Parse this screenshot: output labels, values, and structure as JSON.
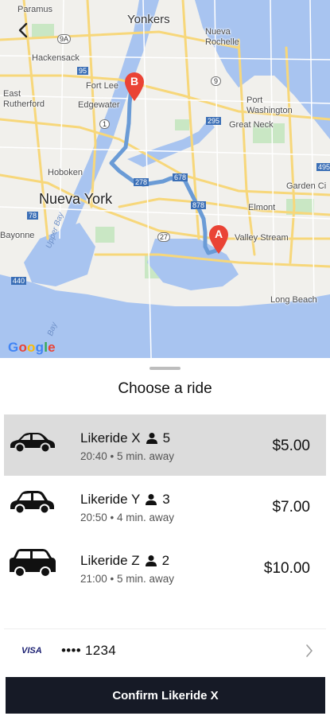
{
  "map": {
    "labels": {
      "paramus": "Paramus",
      "yonkers": "Yonkers",
      "nueva_rochelle": "Nueva\nRochelle",
      "hackensack": "Hackensack",
      "east_rutherford": "East\nRutherford",
      "fort_lee": "Fort Lee",
      "edgewater": "Edgewater",
      "port_washington": "Port\nWashington",
      "great_neck": "Great Neck",
      "hoboken": "Hoboken",
      "nueva_york": "Nueva York",
      "garden_city": "Garden Ci",
      "elmont": "Elmont",
      "valley_stream": "Valley Stream",
      "bayonne": "Bayonne",
      "upper_bay": "Upper Bay",
      "long_beach": "Long Beach",
      "bay": "Bay",
      "highway_95": "95",
      "highway_295": "295",
      "highway_278": "278",
      "highway_878": "878",
      "highway_27": "27",
      "highway_678": "678",
      "highway_9a": "9A",
      "highway_1": "1",
      "highway_495": "495",
      "highway_78": "78",
      "highway_440": "440",
      "highway_9": "9"
    },
    "marker_a": "A",
    "marker_b": "B",
    "google": [
      "G",
      "o",
      "o",
      "g",
      "l",
      "e"
    ],
    "google_colors": [
      "#4285F4",
      "#EA4335",
      "#FBBC05",
      "#4285F4",
      "#34A853",
      "#EA4335"
    ],
    "route_color": "#6a9bd6"
  },
  "sheet": {
    "title": "Choose a ride",
    "rides": [
      {
        "name": "Likeride X",
        "seats": "5",
        "meta": "20:40 • 5 min. away",
        "price": "$5.00",
        "selected": true
      },
      {
        "name": "Likeride Y",
        "seats": "3",
        "meta": "20:50 • 4 min. away",
        "price": "$7.00",
        "selected": false
      },
      {
        "name": "Likeride Z",
        "seats": "2",
        "meta": "21:00 • 5 min. away",
        "price": "$10.00",
        "selected": false
      }
    ],
    "payment": {
      "brand": "VISA",
      "card": "•••• 1234"
    },
    "confirm_label": "Confirm Likeride X"
  }
}
